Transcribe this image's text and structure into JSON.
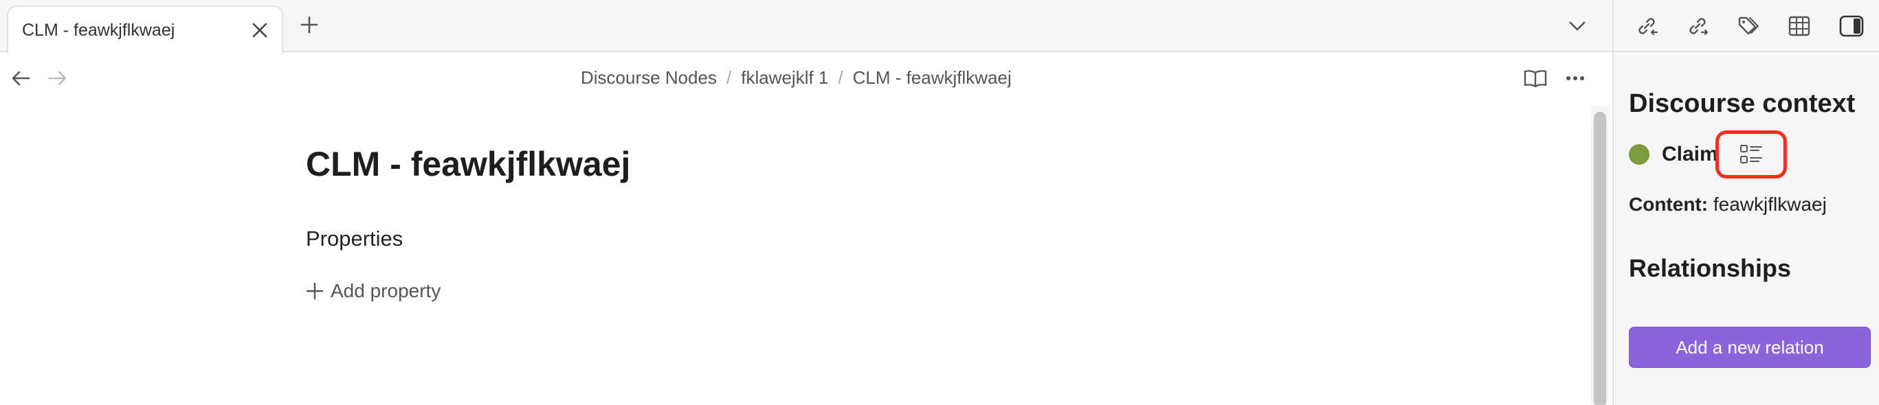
{
  "tab": {
    "title": "CLM - feawkjflkwaej"
  },
  "breadcrumb": {
    "items": [
      "Discourse Nodes",
      "fklawejklf 1",
      "CLM - feawkjflkwaej"
    ],
    "separator": "/"
  },
  "note": {
    "title": "CLM - feawkjflkwaej",
    "properties_heading": "Properties",
    "add_property_label": "Add property"
  },
  "sidebar": {
    "context_title": "Discourse context",
    "node_type": "Claim",
    "node_color": "#7a9c3f",
    "content_label": "Content:",
    "content_value": "feawkjflkwaej",
    "relationships_title": "Relationships",
    "add_relation_label": "Add a new relation",
    "accent_color": "#8b63dc",
    "highlight_color": "#ff2a1a"
  },
  "icons": {
    "toolbar": [
      "backlinks-icon",
      "outgoing-links-icon",
      "tags-icon",
      "table-icon",
      "sidebar-toggle-icon"
    ]
  }
}
